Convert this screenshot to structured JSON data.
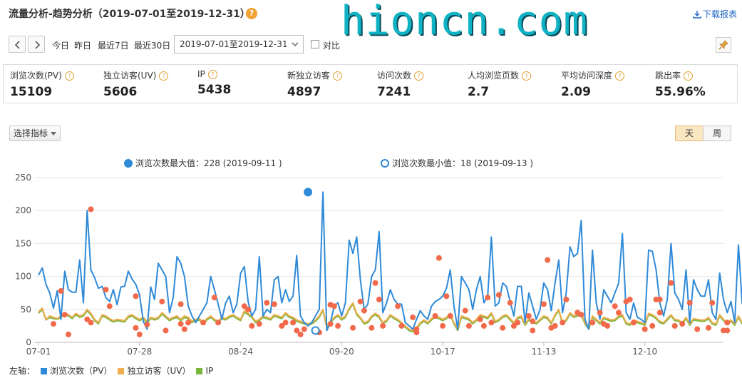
{
  "header": {
    "title": "流量分析-趋势分析（2019-07-01至2019-12-31）",
    "help_glyph": "?",
    "watermark": "hioncn.com",
    "download_label": "下载报表"
  },
  "toolbar": {
    "quick_ranges": [
      "今日",
      "昨日",
      "最近7日",
      "最近30日"
    ],
    "date_range": "2019-07-01至2019-12-31",
    "compare_label": "对比",
    "compare_checked": false
  },
  "metrics": [
    {
      "label": "浏览次数(PV)",
      "value": "15109"
    },
    {
      "label": "独立访客(UV)",
      "value": "5606"
    },
    {
      "label": "IP",
      "value": "5438"
    },
    {
      "label": "新独立访客",
      "value": "4897"
    },
    {
      "label": "访问次数",
      "value": "7241"
    },
    {
      "label": "人均浏览页数",
      "value": "2.7"
    },
    {
      "label": "平均访问深度",
      "value": "2.09"
    },
    {
      "label": "跳出率",
      "value": "55.96%"
    }
  ],
  "controls": {
    "indicator_selector": "选择指标",
    "granularity": [
      {
        "label": "天",
        "active": true
      },
      {
        "label": "周",
        "active": false
      }
    ]
  },
  "colors": {
    "pv": "#2f8ad8",
    "uv": "#f0ad4e",
    "ip": "#78b53a",
    "markers": "#f26a4b",
    "accent": "#f2a233"
  },
  "chart_data": {
    "type": "line",
    "annotations": {
      "max_label": "浏览次数最大值：228 (2019-09-11 )",
      "min_label": "浏览次数最小值：18 (2019-09-13 )",
      "max": {
        "date": "2019-09-11",
        "value": 228
      },
      "min": {
        "date": "2019-09-13",
        "value": 18
      }
    },
    "x_start": "2019-07-01",
    "x_end": "2019-12-31",
    "x_ticks": [
      "07-01",
      "07-28",
      "08-24",
      "09-20",
      "10-17",
      "11-13",
      "12-10"
    ],
    "ylim": [
      0,
      250
    ],
    "y_ticks": [
      0,
      50,
      100,
      150,
      200,
      250
    ],
    "grid": true,
    "legend_prefix": "左轴：",
    "series": [
      {
        "name": "浏览次数（PV）",
        "color": "#2f8ad8",
        "values": [
          102,
          113,
          88,
          75,
          52,
          78,
          35,
          108,
          80,
          76,
          76,
          125,
          60,
          200,
          110,
          98,
          82,
          85,
          68,
          62,
          80,
          57,
          84,
          85,
          108,
          96,
          88,
          72,
          32,
          20,
          84,
          65,
          120,
          110,
          100,
          45,
          68,
          130,
          120,
          100,
          55,
          40,
          30,
          40,
          50,
          60,
          100,
          80,
          58,
          35,
          60,
          70,
          45,
          58,
          105,
          115,
          62,
          40,
          50,
          130,
          40,
          50,
          45,
          95,
          100,
          60,
          80,
          62,
          70,
          132,
          40,
          30,
          25,
          30,
          40,
          50,
          228,
          18,
          30,
          55,
          60,
          40,
          60,
          155,
          135,
          160,
          95,
          50,
          58,
          100,
          110,
          168,
          45,
          60,
          80,
          65,
          58,
          58,
          30,
          25,
          20,
          35,
          48,
          40,
          35,
          55,
          62,
          65,
          70,
          82,
          110,
          55,
          20,
          100,
          90,
          80,
          50,
          80,
          100,
          60,
          70,
          160,
          55,
          60,
          90,
          85,
          62,
          40,
          85,
          85,
          30,
          75,
          55,
          35,
          50,
          90,
          80,
          48,
          90,
          125,
          45,
          75,
          145,
          130,
          135,
          185,
          35,
          20,
          140,
          60,
          35,
          80,
          70,
          60,
          75,
          90,
          165,
          45,
          35,
          60,
          38,
          35,
          30,
          140,
          138,
          110,
          60,
          40,
          65,
          150,
          75,
          65,
          50,
          110,
          30,
          95,
          80,
          70,
          70,
          95,
          45,
          35,
          105,
          65,
          45,
          62,
          30,
          148,
          58
        ]
      },
      {
        "name": "独立访客（UV）",
        "color": "#f0ad4e",
        "values": [
          46,
          52,
          35,
          40,
          38,
          36,
          40,
          45,
          42,
          38,
          44,
          40,
          42,
          50,
          44,
          35,
          30,
          42,
          40,
          36,
          33,
          35,
          34,
          33,
          40,
          42,
          38,
          35,
          38,
          32,
          38,
          36,
          38,
          45,
          40,
          35,
          38,
          40,
          35,
          40,
          38,
          32,
          35,
          36,
          30,
          36,
          40,
          35,
          32,
          38,
          36,
          40,
          42,
          38,
          35,
          48,
          44,
          40,
          32,
          35,
          40,
          38,
          36,
          42,
          40,
          38,
          45,
          40,
          38,
          34,
          32,
          30,
          28,
          30,
          34,
          40,
          50,
          25,
          32,
          38,
          42,
          36,
          40,
          52,
          60,
          44,
          38,
          30,
          32,
          40,
          44,
          40,
          30,
          34,
          42,
          38,
          35,
          30,
          25,
          20,
          18,
          22,
          30,
          34,
          30,
          36,
          40,
          38,
          35,
          38,
          44,
          30,
          20,
          40,
          38,
          36,
          30,
          35,
          42,
          40,
          38,
          45,
          32,
          35,
          40,
          42,
          36,
          30,
          38,
          40,
          28,
          36,
          32,
          30,
          35,
          40,
          38,
          30,
          42,
          50,
          30,
          35,
          45,
          40,
          42,
          44,
          30,
          22,
          40,
          35,
          30,
          38,
          36,
          34,
          35,
          40,
          42,
          30,
          28,
          34,
          32,
          30,
          28,
          44,
          42,
          38,
          32,
          30,
          36,
          42,
          35,
          34,
          30,
          38,
          28,
          36,
          35,
          34,
          34,
          38,
          30,
          28,
          42,
          35,
          30,
          34,
          28,
          40,
          30
        ]
      },
      {
        "name": "IP",
        "color": "#78b53a",
        "values": [
          44,
          50,
          34,
          38,
          36,
          35,
          38,
          43,
          40,
          36,
          42,
          38,
          40,
          48,
          42,
          33,
          28,
          40,
          38,
          34,
          31,
          33,
          32,
          31,
          38,
          40,
          36,
          33,
          36,
          30,
          36,
          34,
          36,
          43,
          38,
          33,
          36,
          38,
          33,
          38,
          36,
          30,
          33,
          34,
          28,
          34,
          38,
          33,
          30,
          36,
          34,
          38,
          40,
          36,
          33,
          46,
          42,
          38,
          30,
          33,
          38,
          36,
          34,
          40,
          38,
          36,
          43,
          38,
          36,
          32,
          30,
          28,
          26,
          28,
          32,
          38,
          48,
          23,
          30,
          36,
          40,
          34,
          38,
          50,
          58,
          42,
          36,
          28,
          30,
          38,
          42,
          38,
          28,
          32,
          40,
          36,
          33,
          28,
          23,
          18,
          16,
          20,
          28,
          32,
          28,
          34,
          38,
          36,
          33,
          36,
          42,
          28,
          18,
          38,
          36,
          34,
          28,
          33,
          40,
          38,
          36,
          43,
          30,
          33,
          38,
          40,
          34,
          28,
          36,
          38,
          26,
          34,
          30,
          28,
          33,
          38,
          36,
          28,
          40,
          48,
          28,
          33,
          43,
          38,
          40,
          42,
          28,
          20,
          38,
          33,
          28,
          36,
          34,
          32,
          33,
          38,
          40,
          28,
          26,
          32,
          30,
          28,
          26,
          42,
          40,
          36,
          30,
          28,
          34,
          40,
          33,
          32,
          28,
          36,
          26,
          34,
          33,
          32,
          32,
          36,
          28,
          26,
          40,
          33,
          28,
          32,
          26,
          38,
          28
        ]
      },
      {
        "color": "#f26a4b",
        "values": [
          [
            4,
            28
          ],
          [
            6,
            78
          ],
          [
            7,
            42
          ],
          [
            8,
            12
          ],
          [
            13,
            35
          ],
          [
            14,
            202
          ],
          [
            14,
            30
          ],
          [
            18,
            80
          ],
          [
            19,
            55
          ],
          [
            26,
            70
          ],
          [
            26,
            22
          ],
          [
            27,
            12
          ],
          [
            29,
            27
          ],
          [
            33,
            62
          ],
          [
            34,
            18
          ],
          [
            38,
            58
          ],
          [
            38,
            28
          ],
          [
            39,
            20
          ],
          [
            40,
            30
          ],
          [
            44,
            30
          ],
          [
            47,
            68
          ],
          [
            48,
            30
          ],
          [
            55,
            55
          ],
          [
            56,
            50
          ],
          [
            57,
            25
          ],
          [
            59,
            28
          ],
          [
            61,
            60
          ],
          [
            63,
            58
          ],
          [
            65,
            25
          ],
          [
            66,
            30
          ],
          [
            68,
            30
          ],
          [
            69,
            18
          ],
          [
            70,
            12
          ],
          [
            71,
            20
          ],
          [
            75,
            15
          ],
          [
            78,
            57
          ],
          [
            78,
            28
          ],
          [
            79,
            55
          ],
          [
            80,
            25
          ],
          [
            84,
            22
          ],
          [
            86,
            62
          ],
          [
            87,
            48
          ],
          [
            89,
            22
          ],
          [
            90,
            90
          ],
          [
            91,
            65
          ],
          [
            92,
            25
          ],
          [
            96,
            55
          ],
          [
            97,
            25
          ],
          [
            100,
            38
          ],
          [
            101,
            15
          ],
          [
            101,
            20
          ],
          [
            106,
            40
          ],
          [
            107,
            128
          ],
          [
            108,
            25
          ],
          [
            109,
            70
          ],
          [
            110,
            40
          ],
          [
            114,
            48
          ],
          [
            115,
            25
          ],
          [
            118,
            35
          ],
          [
            119,
            25
          ],
          [
            120,
            68
          ],
          [
            121,
            30
          ],
          [
            123,
            72
          ],
          [
            124,
            22
          ],
          [
            126,
            60
          ],
          [
            127,
            25
          ],
          [
            128,
            30
          ],
          [
            131,
            40
          ],
          [
            132,
            18
          ],
          [
            132,
            32
          ],
          [
            135,
            58
          ],
          [
            136,
            125
          ],
          [
            137,
            22
          ],
          [
            138,
            25
          ],
          [
            140,
            30
          ],
          [
            141,
            65
          ],
          [
            144,
            45
          ],
          [
            145,
            42
          ],
          [
            148,
            30
          ],
          [
            150,
            45
          ],
          [
            151,
            28
          ],
          [
            152,
            25
          ],
          [
            154,
            55
          ],
          [
            155,
            45
          ],
          [
            157,
            62
          ],
          [
            158,
            65
          ],
          [
            159,
            30
          ],
          [
            162,
            20
          ],
          [
            164,
            25
          ],
          [
            165,
            65
          ],
          [
            166,
            65
          ],
          [
            166,
            45
          ],
          [
            169,
            90
          ],
          [
            170,
            25
          ],
          [
            172,
            28
          ],
          [
            174,
            60
          ],
          [
            176,
            20
          ],
          [
            179,
            22
          ],
          [
            180,
            60
          ],
          [
            183,
            18
          ],
          [
            184,
            30
          ],
          [
            184,
            18
          ]
        ]
      }
    ]
  }
}
